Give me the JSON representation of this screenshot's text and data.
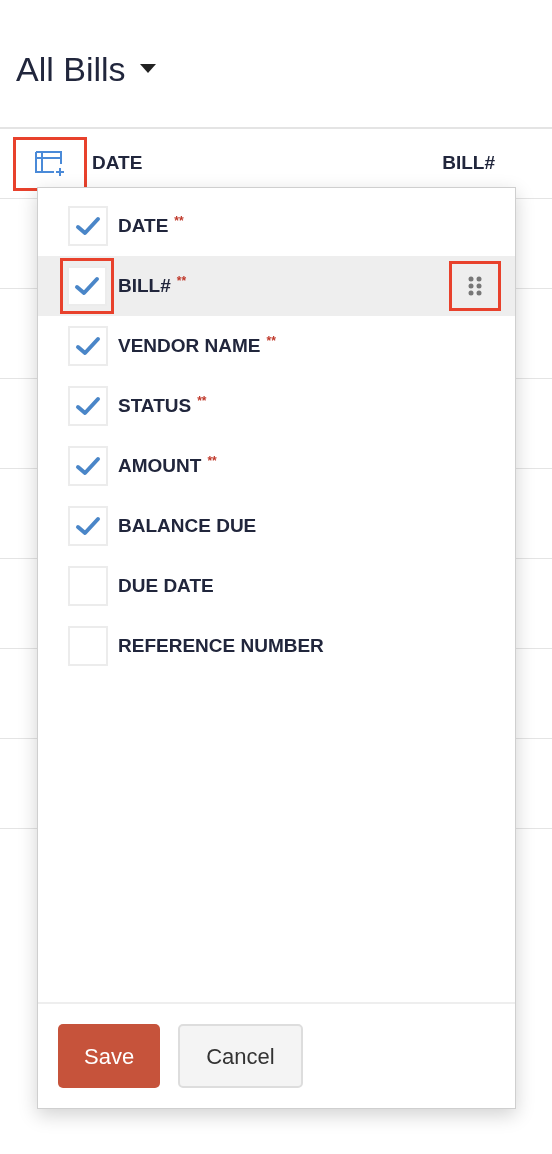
{
  "page_title": "All Bills",
  "table": {
    "column_picker": {
      "highlighted": true
    },
    "columns": [
      "DATE",
      "BILL#"
    ]
  },
  "column_menu": {
    "items": [
      {
        "label": "DATE",
        "required_mark": "**",
        "checked": true,
        "hovered": false,
        "highlighted": false
      },
      {
        "label": "BILL#",
        "required_mark": "**",
        "checked": true,
        "hovered": true,
        "highlighted": true
      },
      {
        "label": "VENDOR NAME",
        "required_mark": "**",
        "checked": true,
        "hovered": false,
        "highlighted": false
      },
      {
        "label": "STATUS",
        "required_mark": "**",
        "checked": true,
        "hovered": false,
        "highlighted": false
      },
      {
        "label": "AMOUNT",
        "required_mark": "**",
        "checked": true,
        "hovered": false,
        "highlighted": false
      },
      {
        "label": "BALANCE DUE",
        "checked": true,
        "hovered": false,
        "highlighted": false
      },
      {
        "label": "DUE DATE",
        "checked": false,
        "hovered": false,
        "highlighted": false
      },
      {
        "label": "REFERENCE NUMBER",
        "checked": false,
        "hovered": false,
        "highlighted": false
      }
    ],
    "buttons": [
      {
        "label": "Save",
        "kind": "primary"
      },
      {
        "label": "Cancel",
        "kind": "secondary"
      }
    ]
  }
}
